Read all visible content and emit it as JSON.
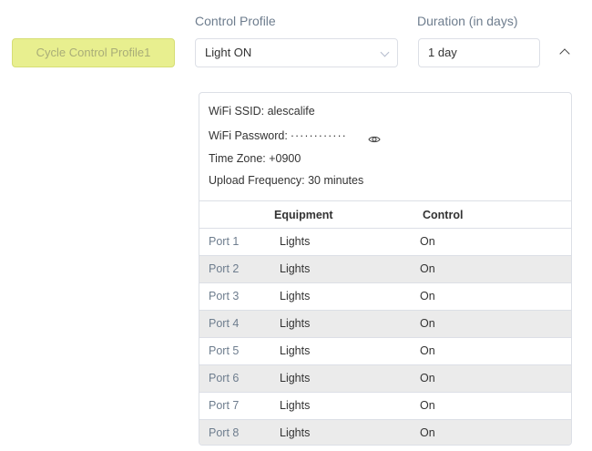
{
  "cycle_button": {
    "label": "Cycle Control Profile1"
  },
  "control_profile": {
    "label": "Control Profile",
    "value": "Light ON"
  },
  "duration": {
    "label": "Duration (in days)",
    "value": "1 day"
  },
  "device": {
    "ssid_line": "WiFi SSID: alescalife",
    "password_label": "WiFi Password:",
    "password_mask": "············",
    "timezone_line": "Time Zone: +0900",
    "upload_line": "Upload Frequency: 30 minutes"
  },
  "table": {
    "headers": {
      "equipment": "Equipment",
      "control": "Control"
    },
    "rows": [
      {
        "port": "Port 1",
        "equipment": "Lights",
        "control": "On"
      },
      {
        "port": "Port 2",
        "equipment": "Lights",
        "control": "On"
      },
      {
        "port": "Port 3",
        "equipment": "Lights",
        "control": "On"
      },
      {
        "port": "Port 4",
        "equipment": "Lights",
        "control": "On"
      },
      {
        "port": "Port 5",
        "equipment": "Lights",
        "control": "On"
      },
      {
        "port": "Port 6",
        "equipment": "Lights",
        "control": "On"
      },
      {
        "port": "Port 7",
        "equipment": "Lights",
        "control": "On"
      },
      {
        "port": "Port 8",
        "equipment": "Lights",
        "control": "On"
      }
    ]
  },
  "icons": {
    "dropdown": "chevron-down-icon",
    "collapse": "chevron-up-icon",
    "reveal": "eye-icon"
  },
  "colors": {
    "accent_button": "#e8ef8f",
    "link_text": "#6e7d8e",
    "row_alt": "#ebebeb"
  }
}
